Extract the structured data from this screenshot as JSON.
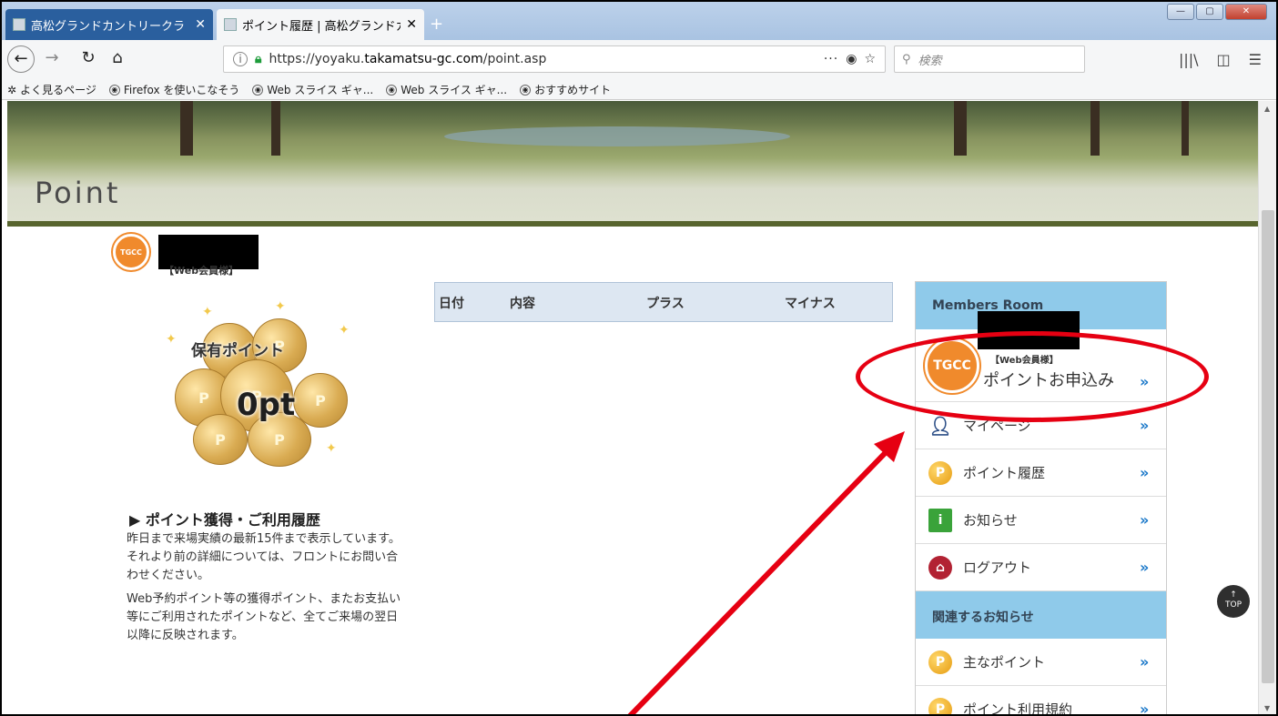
{
  "browser": {
    "tabs": [
      {
        "label": "高松グランドカントリークラ",
        "active": false
      },
      {
        "label": "ポイント履歴 | 高松グランドカ",
        "active": true
      }
    ],
    "new_tab": "+",
    "url_domain_prefix": "https://yoyaku.",
    "url_domain": "takamatsu-gc.com",
    "url_path": "/point.asp",
    "page_actions": "···",
    "search_placeholder": "検索",
    "bookmarks": [
      "よく見るページ",
      "Firefox を使いこなそう",
      "Web スライス ギャ...",
      "Web スライス ギャ...",
      "おすすめサイト"
    ]
  },
  "page": {
    "hero_title": "Point",
    "user_type": "【Web会員様】",
    "logo_text": "TGCC",
    "points": {
      "label": "保有ポイント",
      "value": "0pt"
    },
    "history": {
      "title": "▶ ポイント獲得・ご利用履歴",
      "paragraph1": "昨日まで来場実績の最新15件まで表示しています。それより前の詳細については、フロントにお問い合わせください。",
      "paragraph2": "Web予約ポイント等の獲得ポイント、またお支払い等にご利用されたポイントなど、全てご来場の翌日以降に反映されます。"
    },
    "table_headers": [
      "日付",
      "内容",
      "プラス",
      "マイナス"
    ],
    "sidebar": {
      "members_title": "Members Room",
      "member_type": "【Web会員様】",
      "member_apply": "ポイントお申込み",
      "items": [
        {
          "label": "マイページ",
          "icon": "person-icon"
        },
        {
          "label": "ポイント履歴",
          "icon": "point-coin-icon"
        },
        {
          "label": "お知らせ",
          "icon": "info-icon"
        },
        {
          "label": "ログアウト",
          "icon": "lock-icon"
        }
      ],
      "related_title": "関連するお知らせ",
      "related_items": [
        {
          "label": "主なポイント",
          "icon": "point-coin-icon"
        },
        {
          "label": "ポイント利用規約",
          "icon": "point-coin-icon"
        }
      ]
    },
    "top_button": "TOP"
  },
  "colors": {
    "accent_blue": "#8fcaea",
    "chevron_blue": "#1a78c9",
    "annotation_red": "#e60012",
    "logo_orange": "#f08a2c"
  }
}
